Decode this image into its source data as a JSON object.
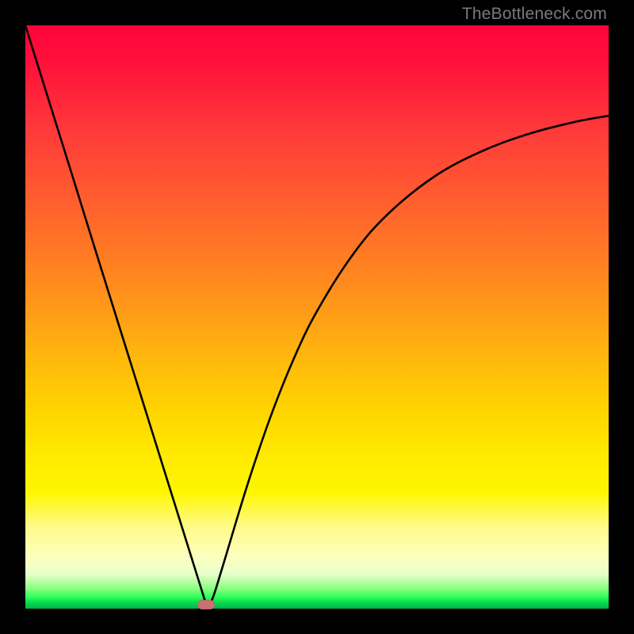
{
  "watermark": "TheBottleneck.com",
  "chart_data": {
    "type": "line",
    "title": "",
    "xlabel": "",
    "ylabel": "",
    "xlim": [
      0,
      1
    ],
    "ylim": [
      0,
      1
    ],
    "grid": false,
    "legend": false,
    "series": [
      {
        "name": "bottleneck-curve",
        "x": [
          0.0,
          0.04,
          0.08,
          0.12,
          0.16,
          0.2,
          0.24,
          0.28,
          0.3,
          0.31,
          0.32,
          0.34,
          0.38,
          0.42,
          0.46,
          0.5,
          0.56,
          0.62,
          0.7,
          0.78,
          0.86,
          0.94,
          1.0
        ],
        "y": [
          1.0,
          0.872,
          0.744,
          0.615,
          0.487,
          0.359,
          0.231,
          0.103,
          0.039,
          0.007,
          0.015,
          0.078,
          0.21,
          0.328,
          0.428,
          0.51,
          0.605,
          0.675,
          0.74,
          0.783,
          0.813,
          0.834,
          0.845
        ]
      }
    ],
    "annotations": [
      {
        "name": "optimum-marker",
        "x": 0.31,
        "y": 0.007,
        "shape": "pill",
        "color": "#c97070"
      }
    ],
    "background_gradient": {
      "direction": "vertical",
      "stops": [
        {
          "pos": 0.0,
          "color": "#ff033a"
        },
        {
          "pos": 0.34,
          "color": "#ff6a2a"
        },
        {
          "pos": 0.66,
          "color": "#ffd400"
        },
        {
          "pos": 0.86,
          "color": "#fffb8a"
        },
        {
          "pos": 0.97,
          "color": "#2eff5a"
        },
        {
          "pos": 1.0,
          "color": "#02b14a"
        }
      ]
    }
  }
}
